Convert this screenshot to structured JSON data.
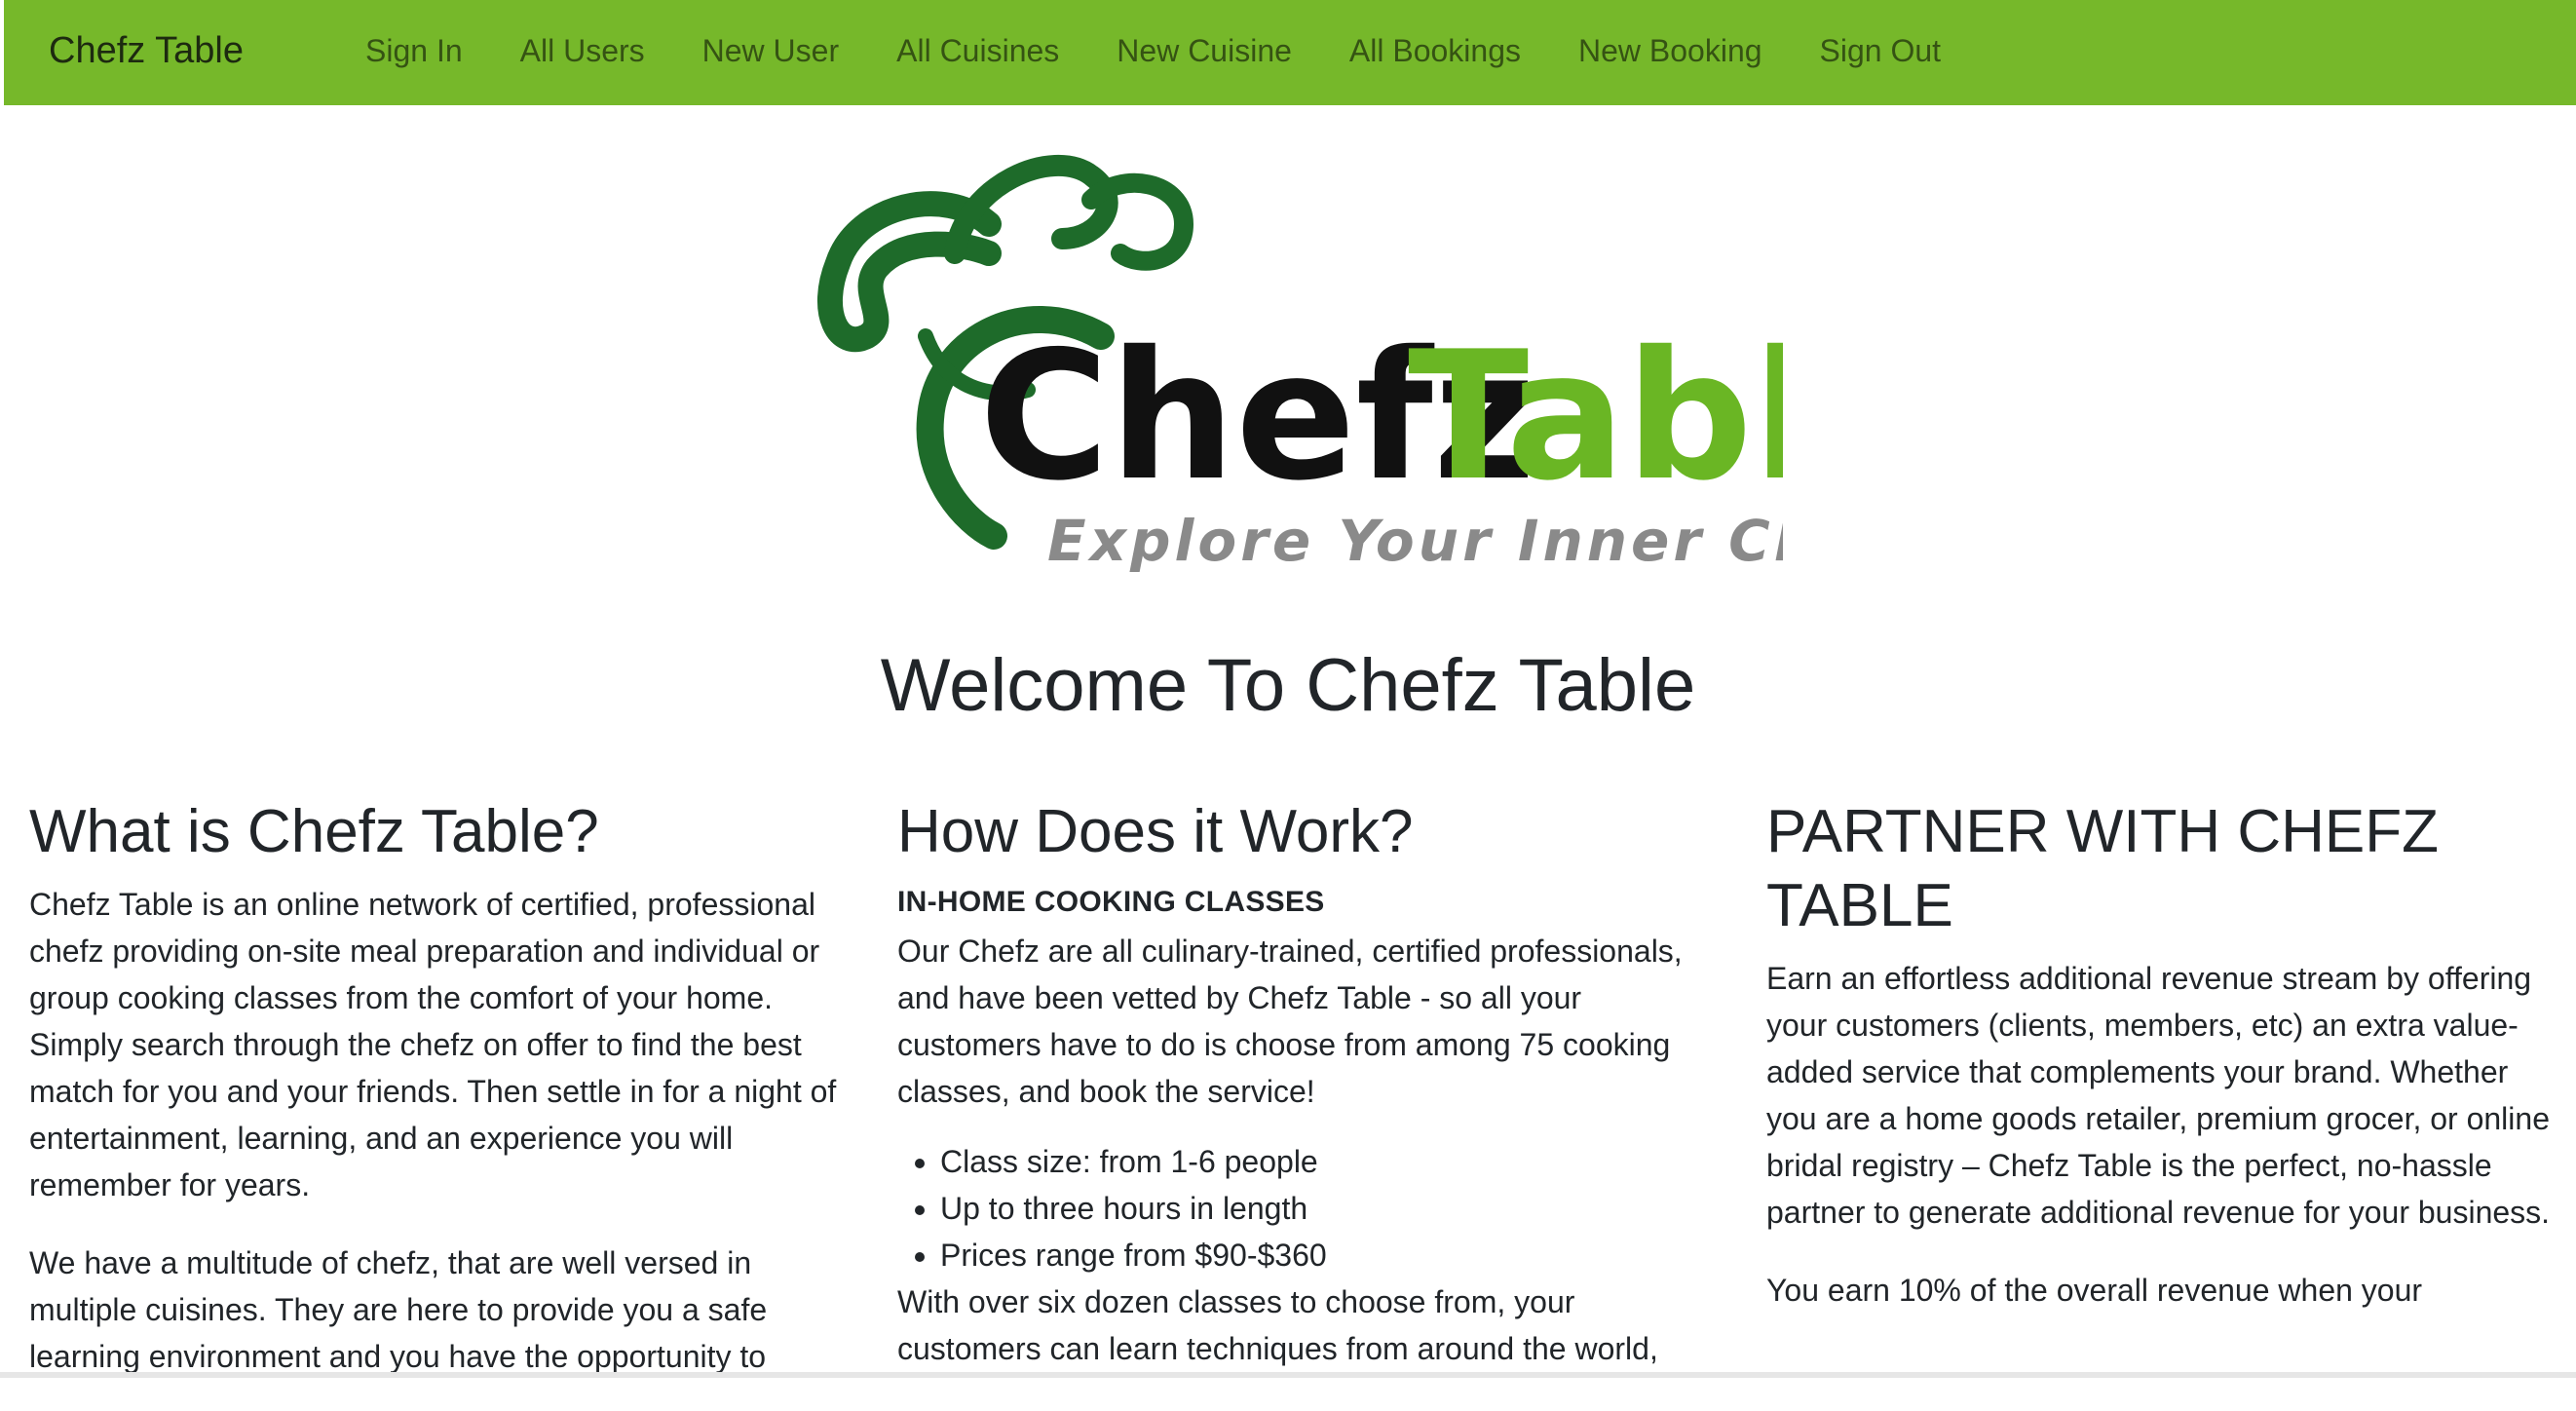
{
  "navbar": {
    "brand": "Chefz Table",
    "links": [
      "Sign In",
      "All Users",
      "New User",
      "All Cuisines",
      "New Cuisine",
      "All Bookings",
      "New Booking",
      "Sign Out"
    ],
    "bg_color": "#76b82a"
  },
  "logo": {
    "word1": "Chefz",
    "word2": "Table",
    "tagline": "Explore Your Inner Chef!"
  },
  "welcome_title": "Welcome To Chefz Table",
  "columns": {
    "what": {
      "title": "What is Chefz Table?",
      "p1": "Chefz Table is an online network of certified, professional chefz providing on-site meal preparation and individual or group cooking classes from the comfort of your home. Simply search through the chefz on offer to find the best match for you and your friends. Then settle in for a night of entertainment, learning, and an experience you will remember for years.",
      "p2": "We have a multitude of chefz, that are well versed in multiple cuisines. They are here to provide you a safe learning environment and you have the opportunity to"
    },
    "how": {
      "title": "How Does it Work?",
      "subhead": "IN-HOME COOKING CLASSES",
      "p1": "Our Chefz are all culinary-trained, certified professionals, and have been vetted by Chefz Table - so all your customers have to do is choose from among 75 cooking classes, and book the service!",
      "bullets": [
        "Class size: from 1-6 people",
        "Up to three hours in length",
        "Prices range from $90-$360"
      ],
      "p2": "With over six dozen classes to choose from, your customers can learn techniques from around the world,"
    },
    "partner": {
      "title": "PARTNER WITH CHEFZ TABLE",
      "p1": "Earn an effortless additional revenue stream by offering your customers (clients, members, etc) an extra value-added service that complements your brand. Whether you are a home goods retailer, premium grocer, or online bridal registry – Chefz Table is the perfect, no-hassle partner to generate additional revenue for your business.",
      "p2": "You earn 10% of the overall revenue when your"
    }
  }
}
